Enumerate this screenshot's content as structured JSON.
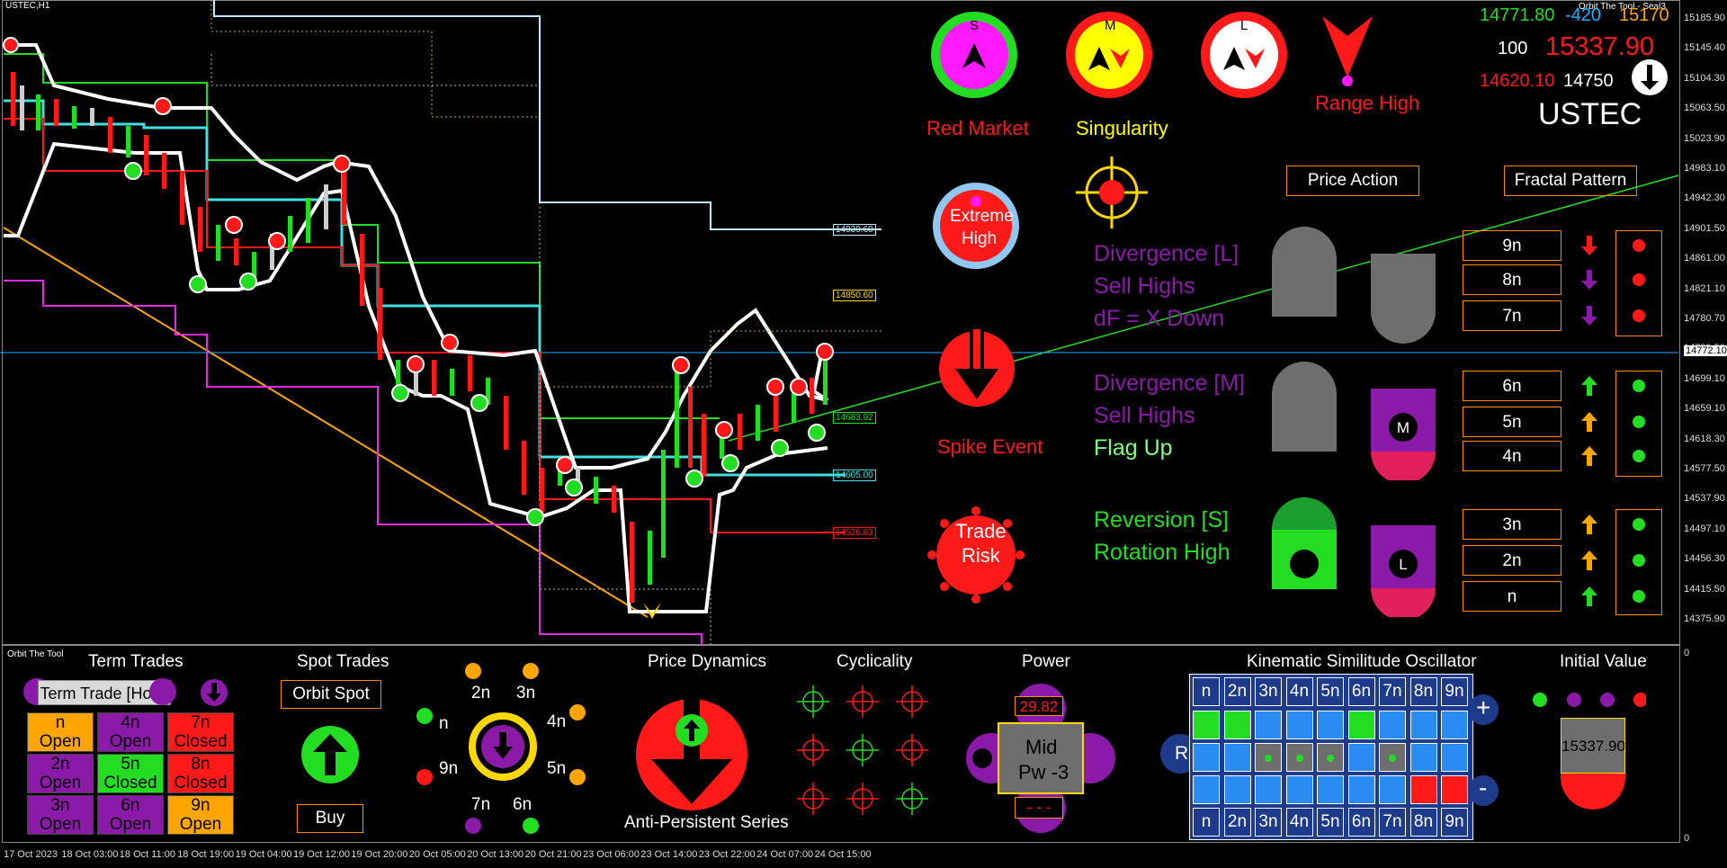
{
  "window": {
    "symbol_tab": "USTEC,H1",
    "indicator_tag": "Orbit The Tool - Seal3",
    "bottom_tag": "Orbit The Tool"
  },
  "top_right": {
    "price_a": "14771.80",
    "price_a_delta": "-420",
    "price_b": "15170",
    "lot": "100",
    "current_price": "15337.90",
    "low_price": "14620.10",
    "mid_price": "14750",
    "symbol": "USTEC"
  },
  "signals": {
    "s_label": "S",
    "m_label": "M",
    "l_label": "L",
    "red_market": "Red Market",
    "singularity": "Singularity",
    "range_high": "Range High",
    "extreme_high_l1": "Extreme",
    "extreme_high_l2": "High",
    "spike_event": "Spike Event",
    "trade_risk_l1": "Trade",
    "trade_risk_l2": "Risk"
  },
  "panels": {
    "price_action": "Price Action",
    "fractal_pattern": "Fractal Pattern"
  },
  "divergence_l": {
    "title": "Divergence [L]",
    "line2": "Sell Highs",
    "line3": "dF = X Down"
  },
  "divergence_m": {
    "title": "Divergence [M]",
    "line2": "Sell Highs",
    "line3": "Flag Up"
  },
  "reversion_s": {
    "title": "Reversion [S]",
    "line2": "Rotation High"
  },
  "fractal_rows": [
    {
      "label": "9n",
      "arrow": "down",
      "color": "#ff1a1a",
      "dot": "#ff1a1a"
    },
    {
      "label": "8n",
      "arrow": "down",
      "color": "#8b1aa8",
      "dot": "#ff1a1a"
    },
    {
      "label": "7n",
      "arrow": "down",
      "color": "#8b1aa8",
      "dot": "#ff1a1a"
    },
    {
      "label": "6n",
      "arrow": "up",
      "color": "#22dd22",
      "dot": "#22dd22"
    },
    {
      "label": "5n",
      "arrow": "up",
      "color": "#ffa500",
      "dot": "#22dd22"
    },
    {
      "label": "4n",
      "arrow": "up",
      "color": "#ffa500",
      "dot": "#22dd22"
    },
    {
      "label": "3n",
      "arrow": "up",
      "color": "#ffa500",
      "dot": "#22dd22"
    },
    {
      "label": "2n",
      "arrow": "up",
      "color": "#ffa500",
      "dot": "#22dd22"
    },
    {
      "label": "n",
      "arrow": "up",
      "color": "#22dd22",
      "dot": "#22dd22"
    }
  ],
  "price_labels": [
    "14939.60",
    "14850.60",
    "14772.10",
    "14683.92",
    "14605.00",
    "14526.83"
  ],
  "yaxis_ticks": [
    "15185.90",
    "15145.40",
    "15104.30",
    "15063.50",
    "15023.90",
    "14983.10",
    "14942.30",
    "14901.50",
    "14861.00",
    "14821.10",
    "14780.70",
    "14739.50",
    "14699.10",
    "14659.10",
    "14618.30",
    "14577.50",
    "14537.90",
    "14497.10",
    "14456.30",
    "14415.50",
    "14375.90"
  ],
  "xaxis_ticks": [
    "17 Oct 2023",
    "18 Oct 03:00",
    "18 Oct 11:00",
    "18 Oct 19:00",
    "19 Oct 04:00",
    "19 Oct 12:00",
    "19 Oct 20:00",
    "20 Oct 05:00",
    "20 Oct 13:00",
    "20 Oct 21:00",
    "23 Oct 06:00",
    "23 Oct 14:00",
    "23 Oct 22:00",
    "24 Oct 07:00",
    "24 Oct 15:00"
  ],
  "sub_axis": {
    "top": "0",
    "bottom": "0"
  },
  "term_trades": {
    "title": "Term Trades",
    "hold_button": "Term Trade [Hold]",
    "cells": [
      {
        "l1": "n",
        "l2": "Open",
        "bg": "#ffa500"
      },
      {
        "l1": "4n",
        "l2": "Open",
        "bg": "#8b1aa8"
      },
      {
        "l1": "7n",
        "l2": "Closed",
        "bg": "#ff1a1a"
      },
      {
        "l1": "2n",
        "l2": "Open",
        "bg": "#8b1aa8"
      },
      {
        "l1": "5n",
        "l2": "Closed",
        "bg": "#22dd22"
      },
      {
        "l1": "8n",
        "l2": "Closed",
        "bg": "#ff1a1a"
      },
      {
        "l1": "3n",
        "l2": "Open",
        "bg": "#8b1aa8"
      },
      {
        "l1": "6n",
        "l2": "Open",
        "bg": "#8b1aa8"
      },
      {
        "l1": "9n",
        "l2": "Open",
        "bg": "#ffa500"
      }
    ]
  },
  "spot_trades": {
    "title": "Spot Trades",
    "orbit_spot": "Orbit Spot",
    "buy": "Buy"
  },
  "orbit_wheel": {
    "labels": [
      "2n",
      "3n",
      "4n",
      "5n",
      "6n",
      "7n",
      "9n",
      "n"
    ]
  },
  "price_dynamics": {
    "title": "Price Dynamics",
    "caption": "Anti-Persistent Series"
  },
  "cyclicality": {
    "title": "Cyclicality"
  },
  "power": {
    "title": "Power",
    "value": "29.82",
    "mid_l1": "Mid",
    "mid_l2": "Pw -3",
    "dashes": "- - -"
  },
  "kso": {
    "title": "Kinematic Similitude Oscillator",
    "header": [
      "n",
      "2n",
      "3n",
      "4n",
      "5n",
      "6n",
      "7n",
      "8n",
      "9n"
    ],
    "footer": [
      "n",
      "2n",
      "3n",
      "4n",
      "5n",
      "6n",
      "7n",
      "8n",
      "9n"
    ],
    "plus": "+",
    "minus": "-",
    "r": "R"
  },
  "initial_value": {
    "title": "Initial Value",
    "value": "15337.90"
  }
}
